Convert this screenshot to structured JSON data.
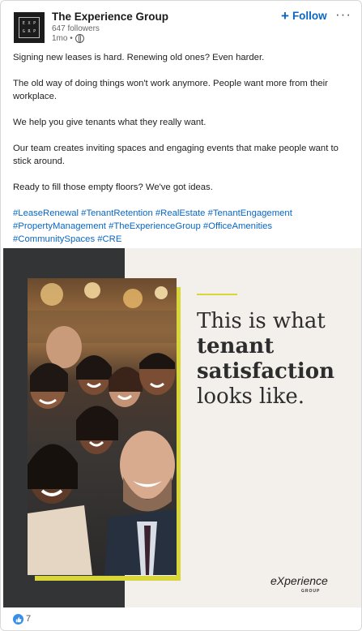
{
  "header": {
    "logo_letters": [
      "E",
      "X",
      "P",
      "G",
      "R",
      "P"
    ],
    "company_name": "The Experience Group",
    "followers": "647 followers",
    "time": "1mo •",
    "follow_label": "Follow",
    "follow_icon": "plus-icon",
    "more_icon": "ellipsis-icon",
    "more_label": "···"
  },
  "post": {
    "paragraphs": [
      "Signing new leases is hard. Renewing old ones? Even harder.",
      "The old way of doing things won't work anymore. People want more from their workplace.",
      "We help you give tenants what they really want.",
      "Our team creates inviting spaces and engaging events that make people want to stick around.",
      "Ready to fill those empty floors? We've got ideas."
    ],
    "hashtags": [
      "#LeaseRenewal",
      "#TenantRetention",
      "#RealEstate",
      "#TenantEngagement",
      "#PropertyManagement",
      "#TheExperienceGroup",
      "#OfficeAmenities",
      "#CommunitySpaces",
      "#CRE"
    ]
  },
  "image": {
    "headline_line1": "This is what",
    "headline_line2": "tenant",
    "headline_line3": "satisfaction",
    "headline_line4": "looks like.",
    "brand": "eXperience",
    "brand_sub": "GROUP",
    "accent_color": "#d9d63a",
    "dark_color": "#333435"
  },
  "footer": {
    "reaction_icon": "thumbs-up-icon",
    "reaction_count": "7"
  }
}
